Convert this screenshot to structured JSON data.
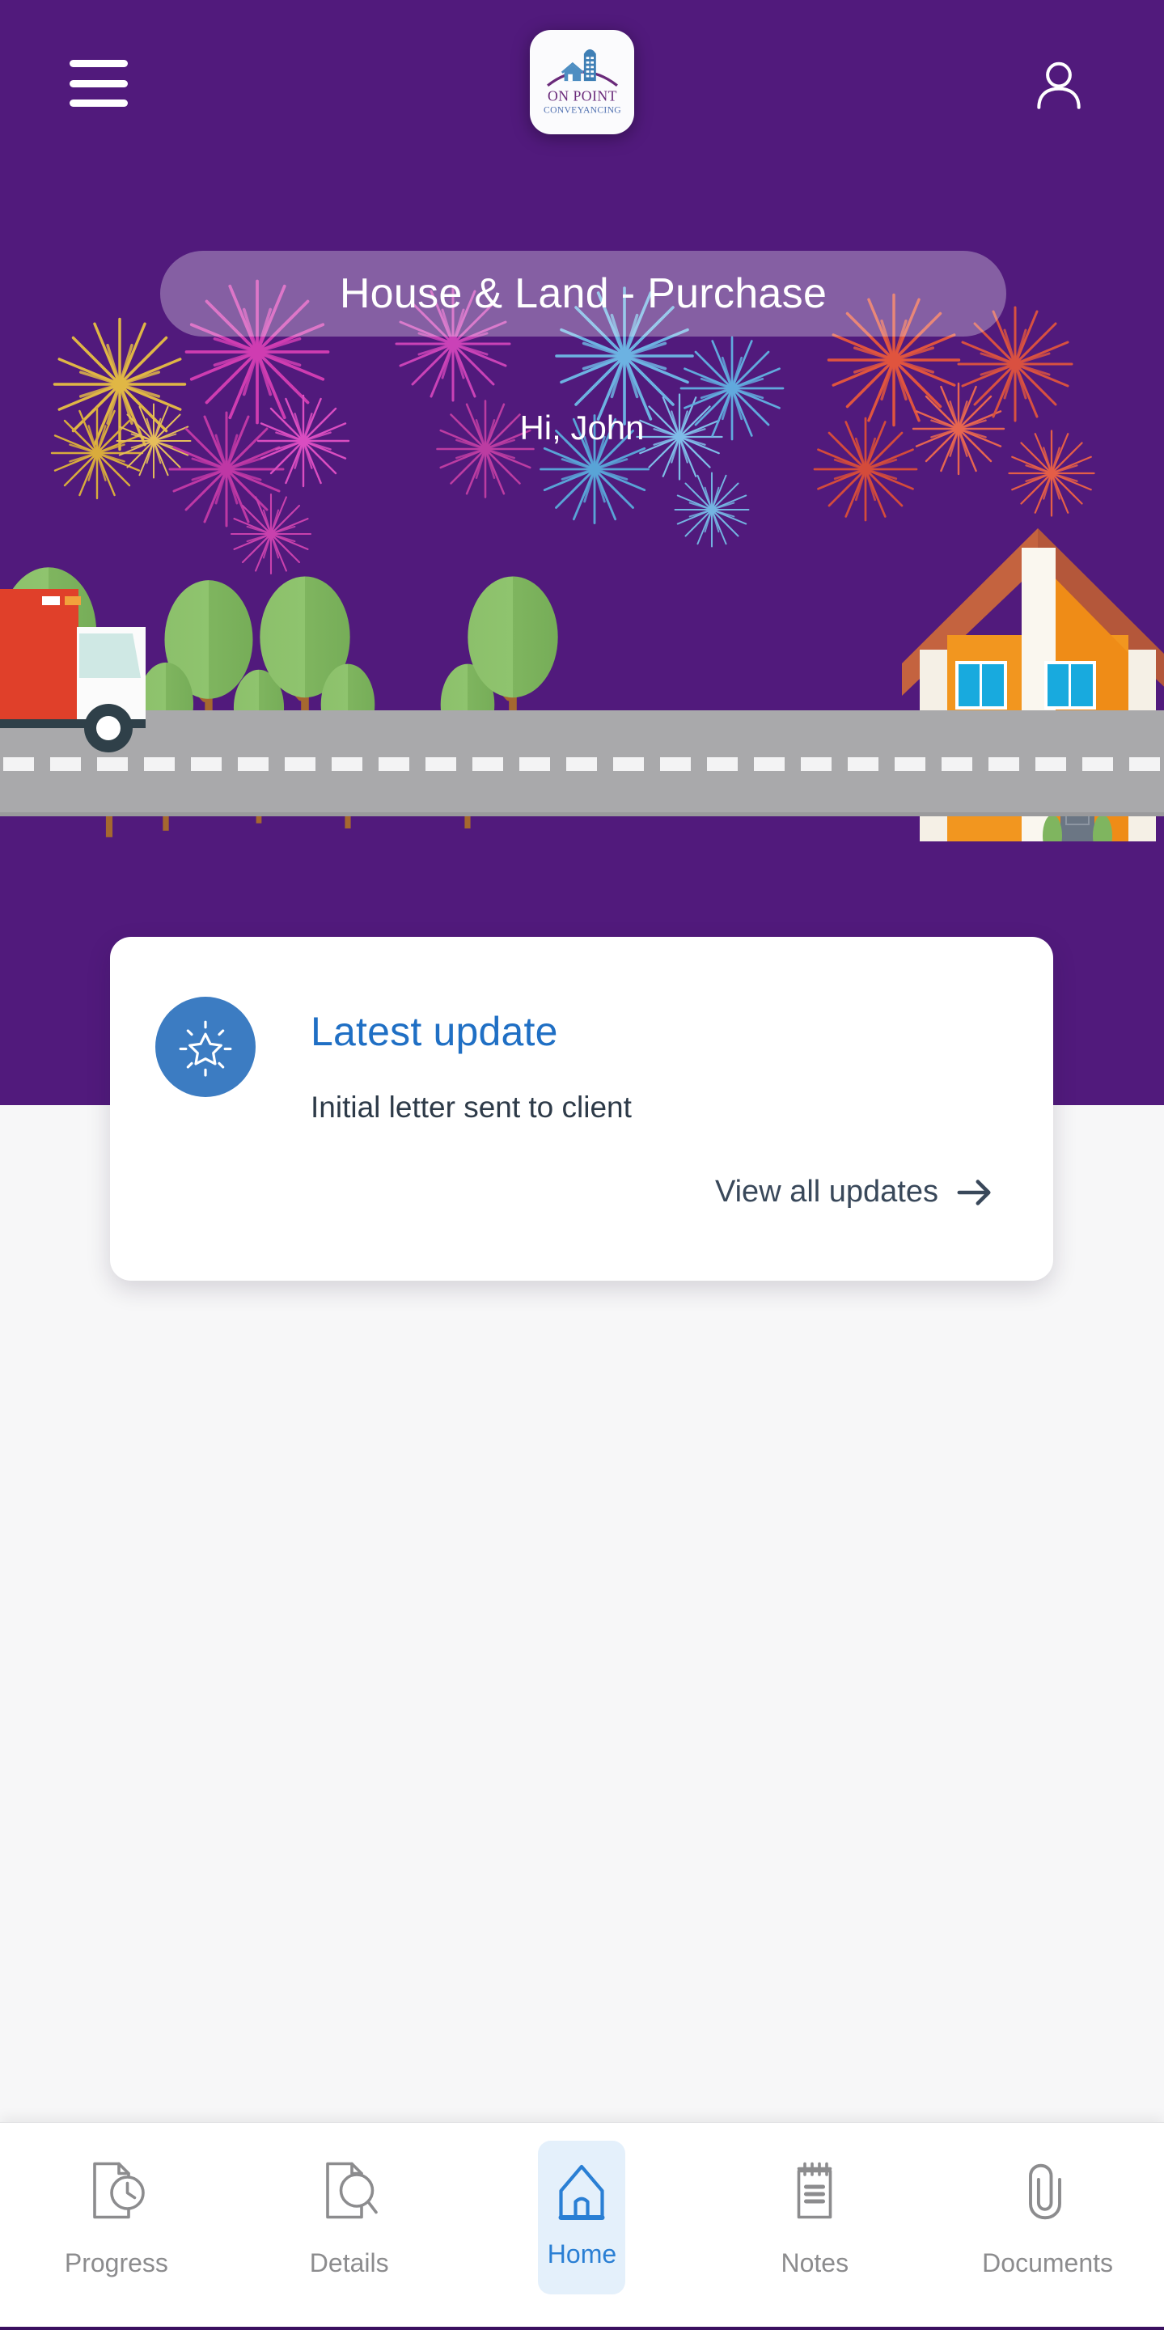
{
  "theme": {
    "brand_purple": "#511a7c",
    "accent_blue": "#2a7fd4",
    "card_white": "#ffffff",
    "page_bg": "#f7f7f8",
    "nav_inactive": "#8c8c8e",
    "active_pill_bg": "#e4f0fb",
    "update_icon_bg": "#3c7cc2",
    "firework_colors": [
      "#e8b93c",
      "#d63fb5",
      "#5fb4e8",
      "#e8583c"
    ]
  },
  "header": {
    "menu_icon": "hamburger-menu-icon",
    "logo": {
      "icon": "on-point-conveyancing-logo",
      "line1": "ON POINT",
      "line2": "CONVEYANCING"
    },
    "profile_icon": "user-profile-icon"
  },
  "hero": {
    "matter_title": "House & Land - Purchase",
    "greeting": "Hi, John",
    "illustration": "moving-truck-house-street-illustration",
    "celebration": "fireworks-background"
  },
  "latest_update": {
    "icon": "sparkle-star-icon",
    "title": "Latest update",
    "message": "Initial letter sent to client",
    "link_label": "View all updates",
    "link_icon": "arrow-right-icon"
  },
  "bottom_nav": {
    "active_index": 2,
    "items": [
      {
        "label": "Progress",
        "icon": "document-clock-icon",
        "active": false
      },
      {
        "label": "Details",
        "icon": "document-search-icon",
        "active": false
      },
      {
        "label": "Home",
        "icon": "house-icon",
        "active": true
      },
      {
        "label": "Notes",
        "icon": "notepad-icon",
        "active": false
      },
      {
        "label": "Documents",
        "icon": "paperclip-icon",
        "active": false
      }
    ]
  }
}
